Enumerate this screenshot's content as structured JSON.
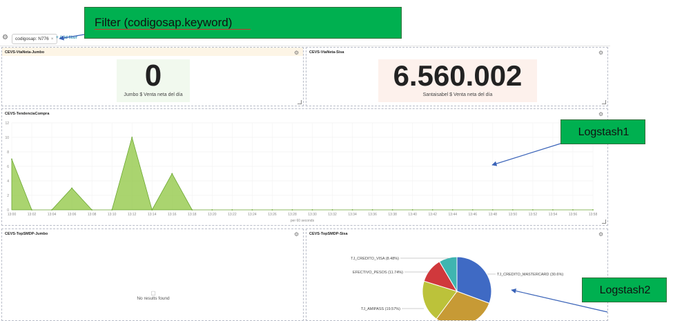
{
  "filter_bar": {
    "pill_label": "codigosap: N776",
    "pill_close": "×",
    "add_filter": "+ Add filter"
  },
  "panels": {
    "jumbo_net": {
      "title": "CEVS-VtaNeta-Jumbo",
      "value": "0",
      "label": "Jumbo $ Venta neta del día"
    },
    "sisa_net": {
      "title": "CEVS-VtaNeta-Sisa",
      "value": "6.560.002",
      "label": "Santaisabel $ Venta neta del día"
    },
    "trend": {
      "title": "CEVS-TendenciaCompra",
      "xlabel": "per 60 seconds"
    },
    "top_jumbo": {
      "title": "CEVS-TopSMDP-Jumbo",
      "empty": "No results found"
    },
    "top_sisa": {
      "title": "CEVS-TopSMDP-Sisa"
    }
  },
  "callouts": {
    "filter": "Filter   (codigosap.keyword)",
    "logstash1": "Logstash1",
    "logstash2": "Logstash2"
  },
  "colors": {
    "area": "#8dc63f",
    "pie_blue": "#3f6ac4",
    "pie_red": "#d0383c",
    "pie_teal": "#3fb5b0",
    "pie_olive": "#bcc23a",
    "pie_brown": "#c79a35"
  },
  "chart_data": [
    {
      "type": "area",
      "x": [
        "13:00",
        "13:02",
        "13:04",
        "13:06",
        "13:08",
        "13:10",
        "13:12",
        "13:14",
        "13:16",
        "13:18",
        "13:20",
        "13:22",
        "13:24",
        "13:26",
        "13:28",
        "13:30",
        "13:32",
        "13:34",
        "13:36",
        "13:38",
        "13:40",
        "13:42",
        "13:44",
        "13:46",
        "13:48",
        "13:50",
        "13:52",
        "13:54",
        "13:56",
        "13:58"
      ],
      "y": [
        7,
        0,
        0,
        3,
        0,
        0,
        10,
        0,
        5,
        0,
        0,
        0,
        0,
        0,
        0,
        0,
        0,
        0,
        0,
        0,
        0,
        0,
        0,
        0,
        0,
        0,
        0,
        0,
        0,
        0
      ],
      "ylim": [
        0,
        12
      ],
      "yticks": [
        0,
        2,
        4,
        6,
        8,
        10,
        12
      ],
      "xlabel": "per 60 seconds"
    },
    {
      "type": "pie",
      "labels": [
        "TJ_CREDITO_VISA (8.48%)",
        "EFECTIVO_PESOS (11.74%)",
        "TJ_AMIPASS (19.57%)",
        "TJ_CREDITO_MASTERCARD (30.6%)"
      ],
      "slices": [
        {
          "name": "TJ_CREDITO_MASTERCARD",
          "value": 30.6,
          "color": "#3f6ac4"
        },
        {
          "name": "",
          "value": 29.61,
          "color": "#c79a35"
        },
        {
          "name": "TJ_AMIPASS",
          "value": 19.57,
          "color": "#bcc23a"
        },
        {
          "name": "EFECTIVO_PESOS",
          "value": 11.74,
          "color": "#d0383c"
        },
        {
          "name": "TJ_CREDITO_VISA",
          "value": 8.48,
          "color": "#3fb5b0"
        }
      ]
    }
  ]
}
